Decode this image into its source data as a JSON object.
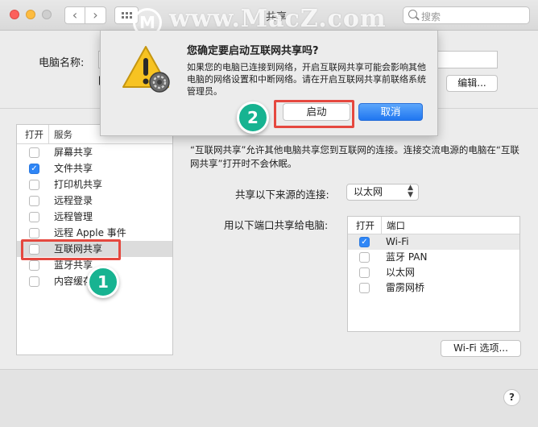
{
  "window": {
    "title": "共享",
    "search_placeholder": "搜索"
  },
  "watermark": {
    "logo_letter": "M",
    "text": "www.MacZ.com"
  },
  "top": {
    "computer_name_label": "电脑名称:",
    "edit_button": "编辑...",
    "partial_char": "["
  },
  "services": {
    "header_open": "打开",
    "header_service": "服务",
    "items": [
      {
        "label": "屏幕共享",
        "checked": false
      },
      {
        "label": "文件共享",
        "checked": true
      },
      {
        "label": "打印机共享",
        "checked": false
      },
      {
        "label": "远程登录",
        "checked": false
      },
      {
        "label": "远程管理",
        "checked": false
      },
      {
        "label": "远程 Apple 事件",
        "checked": false
      },
      {
        "label": "互联网共享",
        "checked": false,
        "selected": true
      },
      {
        "label": "蓝牙共享",
        "checked": false
      },
      {
        "label": "内容缓存",
        "checked": false
      }
    ]
  },
  "detail": {
    "description": "“互联网共享”允许其他电脑共享您到互联网的连接。连接交流电源的电脑在“互联网共享”打开时不会休眠。",
    "share_from_label": "共享以下来源的连接:",
    "share_from_value": "以太网",
    "share_to_label": "用以下端口共享给电脑:",
    "ports_header_open": "打开",
    "ports_header_port": "端口",
    "ports": [
      {
        "label": "Wi-Fi",
        "checked": true
      },
      {
        "label": "蓝牙 PAN",
        "checked": false
      },
      {
        "label": "以太网",
        "checked": false
      },
      {
        "label": "雷雳网桥",
        "checked": false
      }
    ],
    "wifi_options_button": "Wi-Fi 选项...",
    "help": "?"
  },
  "dialog": {
    "title": "您确定要启动互联网共享吗?",
    "body": "如果您的电脑已连接到网络，开启互联网共享可能会影响其他电脑的网络设置和中断网络。请在开启互联网共享前联络系统管理员。",
    "start_button": "启动",
    "cancel_button": "取消"
  },
  "annotations": {
    "step1": "1",
    "step2": "2"
  },
  "colors": {
    "accent_blue": "#2f86f6",
    "highlight_red": "#e5483f",
    "badge_green": "#17b391"
  }
}
